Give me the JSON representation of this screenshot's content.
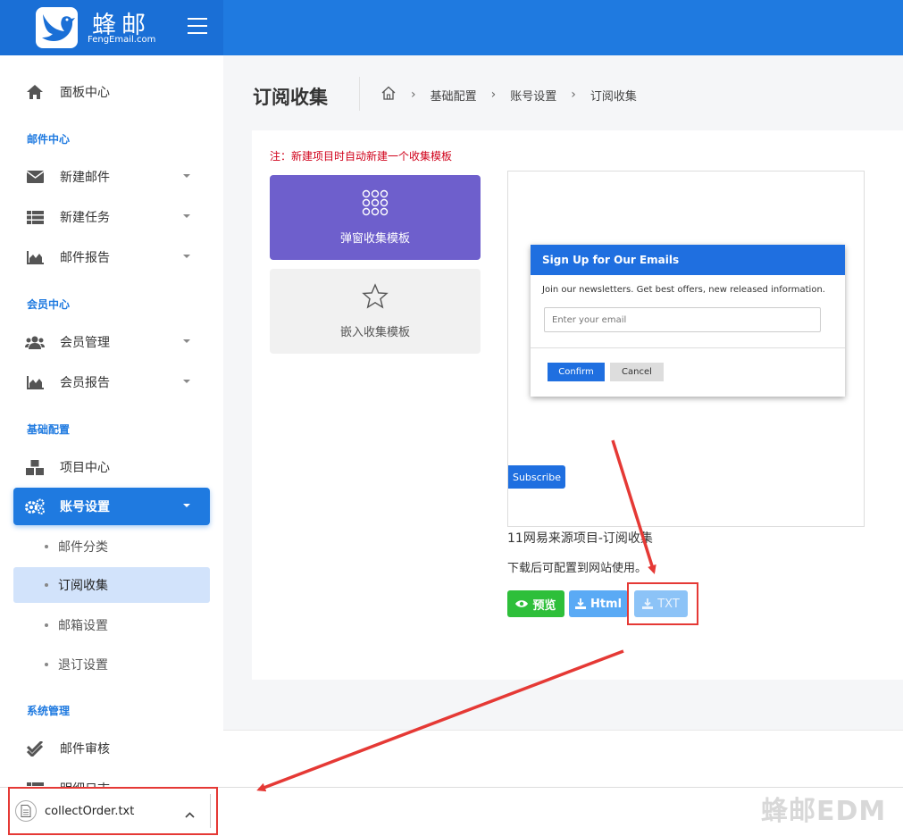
{
  "brand": {
    "name": "蜂邮",
    "subtitle": "FengEmail.com"
  },
  "sidebar": {
    "dashboard": "面板中心",
    "sections": {
      "mail": "邮件中心",
      "member": "会员中心",
      "basic": "基础配置",
      "system": "系统管理"
    },
    "items": {
      "new_mail": "新建邮件",
      "new_task": "新建任务",
      "mail_report": "邮件报告",
      "member_manage": "会员管理",
      "member_report": "会员报告",
      "project_center": "项目中心",
      "account_settings": "账号设置",
      "mail_review": "邮件审核",
      "partial": "明细日志"
    },
    "sub_items": [
      "邮件分类",
      "订阅收集",
      "邮箱设置",
      "退订设置"
    ]
  },
  "page": {
    "title": "订阅收集",
    "breadcrumb": [
      "基础配置",
      "账号设置",
      "订阅收集"
    ]
  },
  "content": {
    "note": "注：新建项目时自动新建一个收集模板",
    "templates": {
      "popup": "弹窗收集模板",
      "embed": "嵌入收集模板"
    },
    "preview": {
      "modal_title": "Sign Up for Our Emails",
      "modal_desc": "Join our newsletters. Get best offers, new released information.",
      "email_placeholder": "Enter your email",
      "confirm": "Confirm",
      "cancel": "Cancel",
      "subscribe": "Subscribe"
    },
    "project_name": "11网易来源项目-订阅收集",
    "hint": "下载后可配置到网站使用。",
    "buttons": {
      "preview": "预览",
      "html": "Html",
      "txt": "TXT"
    }
  },
  "download_bar": {
    "filename": "collectOrder.txt"
  },
  "watermark": "蜂邮EDM",
  "colors": {
    "primary": "#1f7ae0",
    "popup_card": "#6e5fcc",
    "preview_btn": "#2ebf3a",
    "annotation": "#e53935"
  }
}
